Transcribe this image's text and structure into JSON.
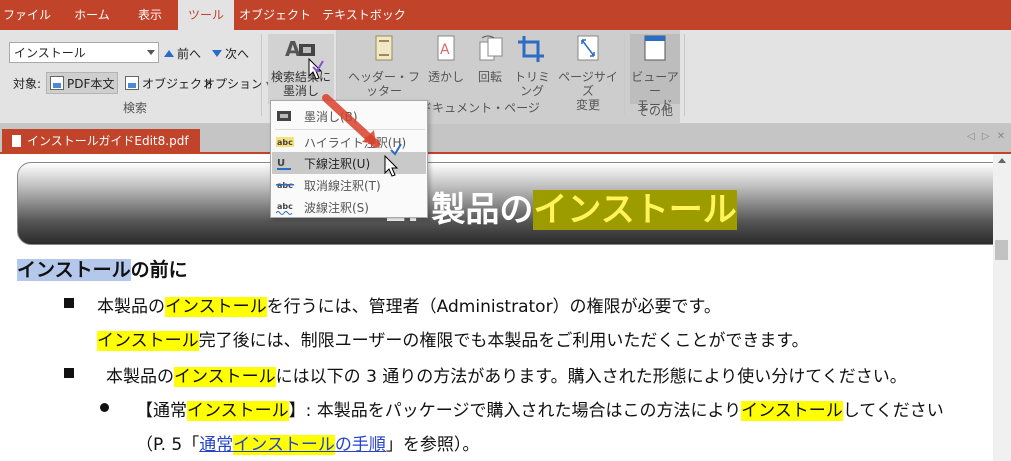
{
  "ribbon_tabs": [
    {
      "label": "ファイル",
      "active": false
    },
    {
      "label": "ホーム",
      "active": false
    },
    {
      "label": "表示",
      "active": false
    },
    {
      "label": "ツール",
      "active": true
    },
    {
      "label": "オブジェクト",
      "active": false
    },
    {
      "label": "テキストボックス",
      "active": false
    }
  ],
  "search_group": {
    "query_value": "インストール",
    "prev_label": "前へ",
    "next_label": "次へ",
    "target_label": "対象:",
    "pdf_text_label": "PDF本文",
    "object_label": "オブジェクト",
    "options_label": "オプション",
    "group_label": "検索"
  },
  "redact_button": {
    "line1": "検索結果に",
    "line2": "墨消し"
  },
  "doc_page_group": {
    "header_footer": "ヘッダー・フッター",
    "watermark": "透かし",
    "rotate": "回転",
    "trim": "トリミング",
    "page_size_line1": "ページサイズ",
    "page_size_line2": "変更",
    "group_label": "ドキュメント・ページ"
  },
  "other_group": {
    "viewer_line1": "ビューアー",
    "viewer_line2": "モード",
    "group_label": "その他"
  },
  "dropdown": {
    "items": [
      {
        "label": "墨消し(B)",
        "icon": "redact-icon"
      },
      {
        "label": "ハイライト注釈(H)",
        "icon": "highlight-icon"
      },
      {
        "label": "下線注釈(U)",
        "icon": "underline-icon"
      },
      {
        "label": "取消線注釈(T)",
        "icon": "strikethrough-icon"
      },
      {
        "label": "波線注釈(S)",
        "icon": "wavy-line-icon"
      }
    ],
    "hover_index": 2
  },
  "document": {
    "tab_label": "インストールガイドEdit8.pdf",
    "banner": {
      "prefix": "1.  製品の",
      "highlight": "インストール"
    },
    "heading": {
      "highlight": "インストール",
      "rest": "の前に"
    },
    "p1": {
      "a": "本製品の",
      "hl": "インストール",
      "b": "を行うには、管理者（Administrator）の権限が必要です。"
    },
    "p2": {
      "hl": "インストール",
      "b": "完了後には、制限ユーザーの権限でも本製品をご利用いただくことができます。"
    },
    "p3": {
      "a": "本製品の",
      "hl": "インストール",
      "b": "には以下の 3 通りの方法があります。購入された形態により使い分けてください。"
    },
    "p4": {
      "a": "【通常",
      "hl": "インストール",
      "b": "】: 本製品をパッケージで購入された場合はこの方法により",
      "hl2": "インストール",
      "c": "してください"
    },
    "p5": {
      "a": "（P. 5「",
      "link_a": "通常",
      "link_hl": "インストール",
      "link_b": "の手順",
      "b": "」を参照）。"
    }
  },
  "colors": {
    "accent": "#c0432a",
    "highlight": "#ffff00",
    "link": "#2644c9"
  }
}
